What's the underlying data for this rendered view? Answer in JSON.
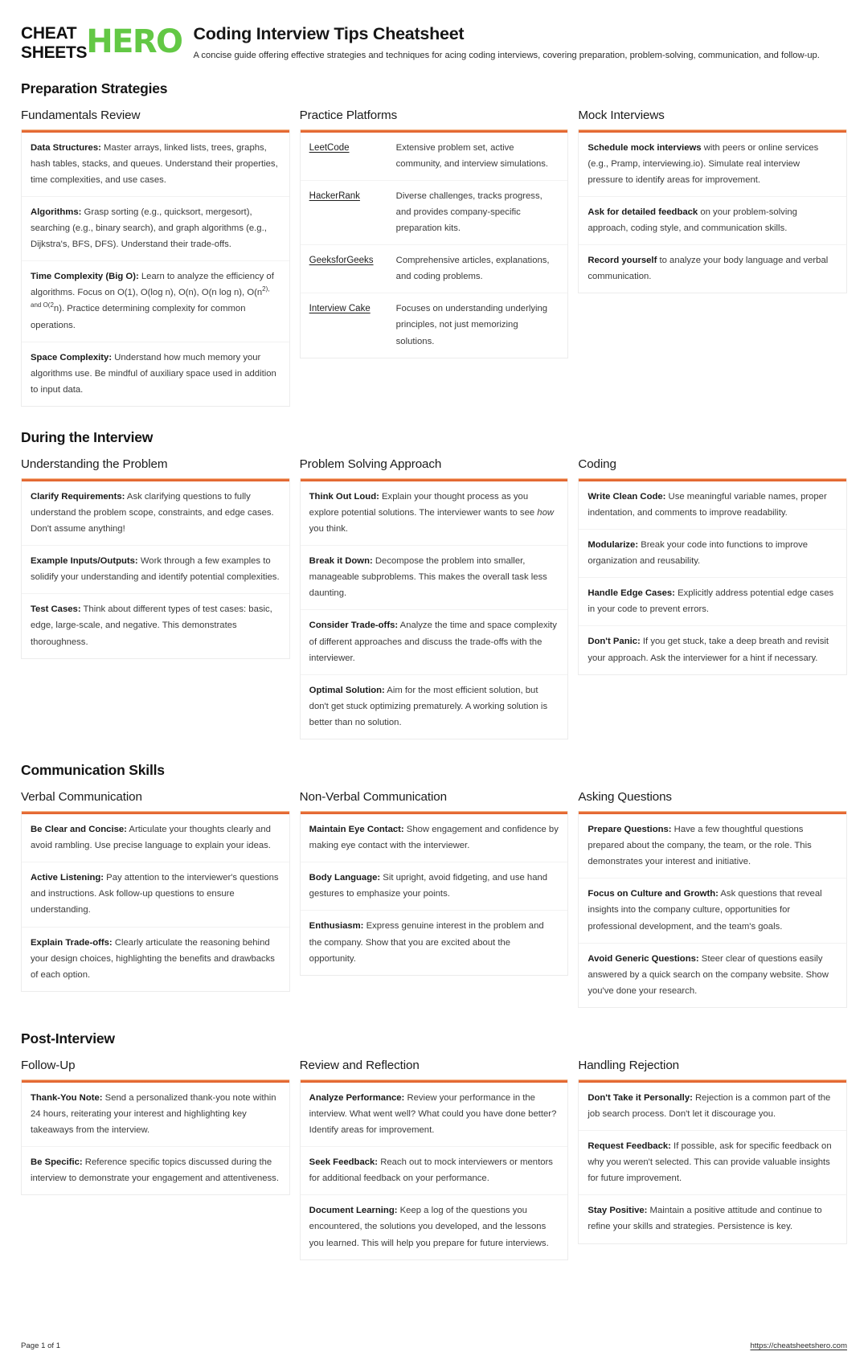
{
  "brand": {
    "logo_line1": "CHEAT",
    "logo_line2": "SHEETS",
    "logo_hero": "HERO",
    "green": "#63c845",
    "accent_orange": "#e8713c"
  },
  "header": {
    "title": "Coding Interview Tips Cheatsheet",
    "subtitle": "A concise guide offering effective strategies and techniques for acing coding interviews, covering preparation, problem-solving, communication, and follow-up."
  },
  "sections": [
    {
      "heading": "Preparation Strategies",
      "cards": [
        {
          "title": "Fundamentals Review",
          "type": "list",
          "rows": [
            {
              "term": "Data Structures:",
              "text": " Master arrays, linked lists, trees, graphs, hash tables, stacks, and queues. Understand their properties, time complexities, and use cases."
            },
            {
              "term": "Algorithms:",
              "text": " Grasp sorting (e.g., quicksort, mergesort), searching (e.g., binary search), and graph algorithms (e.g., Dijkstra's, BFS, DFS). Understand their trade-offs."
            },
            {
              "term": "Time Complexity (Big O):",
              "text": " Learn to analyze the efficiency of algorithms. Focus on O(1), O(log n), O(n), O(n log n), O(n",
              "sup": "2), and O(2",
              "text2": "n). Practice determining complexity for common operations."
            },
            {
              "term": "Space Complexity:",
              "text": " Understand how much memory your algorithms use. Be mindful of auxiliary space used in addition to input data."
            }
          ]
        },
        {
          "title": "Practice Platforms",
          "type": "kv",
          "rows": [
            {
              "key": "LeetCode",
              "value": "Extensive problem set, active community, and interview simulations."
            },
            {
              "key": "HackerRank",
              "value": "Diverse challenges, tracks progress, and provides company-specific preparation kits."
            },
            {
              "key": "GeeksforGeeks",
              "value": "Comprehensive articles, explanations, and coding problems."
            },
            {
              "key": "Interview Cake",
              "value": "Focuses on understanding underlying principles, not just memorizing solutions."
            }
          ]
        },
        {
          "title": "Mock Interviews",
          "type": "list",
          "rows": [
            {
              "term": "Schedule mock interviews",
              "text": " with peers or online services (e.g., Pramp, interviewing.io). Simulate real interview pressure to identify areas for improvement."
            },
            {
              "term": "Ask for detailed feedback",
              "text": " on your problem-solving approach, coding style, and communication skills."
            },
            {
              "term": "Record yourself",
              "text": " to analyze your body language and verbal communication."
            }
          ]
        }
      ]
    },
    {
      "heading": "During the Interview",
      "cards": [
        {
          "title": "Understanding the Problem",
          "type": "list",
          "rows": [
            {
              "term": "Clarify Requirements:",
              "text": " Ask clarifying questions to fully understand the problem scope, constraints, and edge cases. Don't assume anything!"
            },
            {
              "term": "Example Inputs/Outputs:",
              "text": " Work through a few examples to solidify your understanding and identify potential complexities."
            },
            {
              "term": "Test Cases:",
              "text": " Think about different types of test cases: basic, edge, large-scale, and negative. This demonstrates thoroughness."
            }
          ]
        },
        {
          "title": "Problem Solving Approach",
          "type": "list",
          "rows": [
            {
              "term": "Think Out Loud:",
              "text": " Explain your thought process as you explore potential solutions. The interviewer wants to see ",
              "italic": "how",
              "text2": " you think."
            },
            {
              "term": "Break it Down:",
              "text": " Decompose the problem into smaller, manageable subproblems. This makes the overall task less daunting."
            },
            {
              "term": "Consider Trade-offs:",
              "text": " Analyze the time and space complexity of different approaches and discuss the trade-offs with the interviewer."
            },
            {
              "term": "Optimal Solution:",
              "text": " Aim for the most efficient solution, but don't get stuck optimizing prematurely. A working solution is better than no solution."
            }
          ]
        },
        {
          "title": "Coding",
          "type": "list",
          "rows": [
            {
              "term": "Write Clean Code:",
              "text": " Use meaningful variable names, proper indentation, and comments to improve readability."
            },
            {
              "term": "Modularize:",
              "text": " Break your code into functions to improve organization and reusability."
            },
            {
              "term": "Handle Edge Cases:",
              "text": " Explicitly address potential edge cases in your code to prevent errors."
            },
            {
              "term": "Don't Panic:",
              "text": " If you get stuck, take a deep breath and revisit your approach. Ask the interviewer for a hint if necessary."
            }
          ]
        }
      ]
    },
    {
      "heading": "Communication Skills",
      "cards": [
        {
          "title": "Verbal Communication",
          "type": "list",
          "rows": [
            {
              "term": "Be Clear and Concise:",
              "text": " Articulate your thoughts clearly and avoid rambling. Use precise language to explain your ideas."
            },
            {
              "term": "Active Listening:",
              "text": " Pay attention to the interviewer's questions and instructions. Ask follow-up questions to ensure understanding."
            },
            {
              "term": "Explain Trade-offs:",
              "text": " Clearly articulate the reasoning behind your design choices, highlighting the benefits and drawbacks of each option."
            }
          ]
        },
        {
          "title": "Non-Verbal Communication",
          "type": "list",
          "rows": [
            {
              "term": "Maintain Eye Contact:",
              "text": " Show engagement and confidence by making eye contact with the interviewer."
            },
            {
              "term": "Body Language:",
              "text": " Sit upright, avoid fidgeting, and use hand gestures to emphasize your points."
            },
            {
              "term": "Enthusiasm:",
              "text": " Express genuine interest in the problem and the company. Show that you are excited about the opportunity."
            }
          ]
        },
        {
          "title": "Asking Questions",
          "type": "list",
          "rows": [
            {
              "term": "Prepare Questions:",
              "text": " Have a few thoughtful questions prepared about the company, the team, or the role. This demonstrates your interest and initiative."
            },
            {
              "term": "Focus on Culture and Growth:",
              "text": " Ask questions that reveal insights into the company culture, opportunities for professional development, and the team's goals."
            },
            {
              "term": "Avoid Generic Questions:",
              "text": " Steer clear of questions easily answered by a quick search on the company website. Show you've done your research."
            }
          ]
        }
      ]
    },
    {
      "heading": "Post-Interview",
      "cards": [
        {
          "title": "Follow-Up",
          "type": "list",
          "rows": [
            {
              "term": "Thank-You Note:",
              "text": " Send a personalized thank-you note within 24 hours, reiterating your interest and highlighting key takeaways from the interview."
            },
            {
              "term": "Be Specific:",
              "text": " Reference specific topics discussed during the interview to demonstrate your engagement and attentiveness."
            }
          ]
        },
        {
          "title": "Review and Reflection",
          "type": "list",
          "rows": [
            {
              "term": "Analyze Performance:",
              "text": " Review your performance in the interview. What went well? What could you have done better? Identify areas for improvement."
            },
            {
              "term": "Seek Feedback:",
              "text": " Reach out to mock interviewers or mentors for additional feedback on your performance."
            },
            {
              "term": "Document Learning:",
              "text": " Keep a log of the questions you encountered, the solutions you developed, and the lessons you learned. This will help you prepare for future interviews."
            }
          ]
        },
        {
          "title": "Handling Rejection",
          "type": "list",
          "rows": [
            {
              "term": "Don't Take it Personally:",
              "text": " Rejection is a common part of the job search process. Don't let it discourage you."
            },
            {
              "term": "Request Feedback:",
              "text": " If possible, ask for specific feedback on why you weren't selected. This can provide valuable insights for future improvement."
            },
            {
              "term": "Stay Positive:",
              "text": " Maintain a positive attitude and continue to refine your skills and strategies. Persistence is key."
            }
          ]
        }
      ]
    }
  ],
  "footer": {
    "page_label": "Page 1 of 1",
    "url": "https://cheatsheetshero.com"
  }
}
